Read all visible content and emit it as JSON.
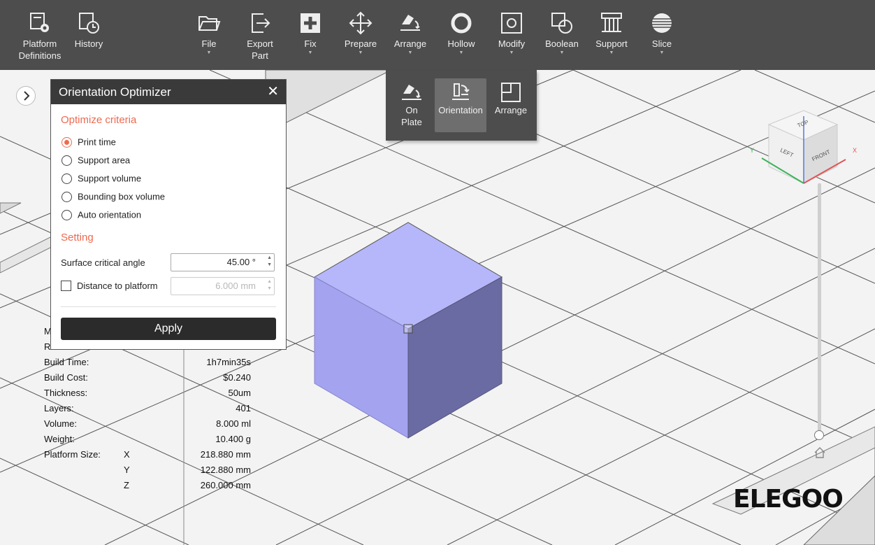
{
  "toolbar": {
    "buttons": [
      {
        "id": "platform",
        "label_line1": "Platform",
        "label_line2": "Definitions",
        "icon": "platform-gear-icon"
      },
      {
        "id": "history",
        "label_line1": "History",
        "label_line2": "",
        "icon": "history-clock-icon"
      },
      {
        "id": "file",
        "label_line1": "File",
        "label_line2": "",
        "icon": "folder-icon"
      },
      {
        "id": "export",
        "label_line1": "Export",
        "label_line2": "Part",
        "icon": "export-icon"
      },
      {
        "id": "fix",
        "label_line1": "Fix",
        "label_line2": "",
        "icon": "fix-plus-icon"
      },
      {
        "id": "prepare",
        "label_line1": "Prepare",
        "label_line2": "",
        "icon": "move-arrows-icon"
      },
      {
        "id": "arrange",
        "label_line1": "Arrange",
        "label_line2": "",
        "icon": "arrange-icon"
      },
      {
        "id": "hollow",
        "label_line1": "Hollow",
        "label_line2": "",
        "icon": "hollow-ring-icon"
      },
      {
        "id": "modify",
        "label_line1": "Modify",
        "label_line2": "",
        "icon": "modify-square-icon"
      },
      {
        "id": "boolean",
        "label_line1": "Boolean",
        "label_line2": "",
        "icon": "boolean-icon"
      },
      {
        "id": "support",
        "label_line1": "Support",
        "label_line2": "",
        "icon": "support-icon"
      },
      {
        "id": "slice",
        "label_line1": "Slice",
        "label_line2": "",
        "icon": "slice-layers-icon"
      }
    ]
  },
  "arrange_menu": {
    "on_plate_line1": "On",
    "on_plate_line2": "Plate",
    "orientation": "Orientation",
    "arrange": "Arrange",
    "active": "orientation"
  },
  "optimizer": {
    "title": "Orientation Optimizer",
    "close": "✕",
    "criteria_title": "Optimize criteria",
    "criteria": [
      {
        "label": "Print time",
        "checked": true
      },
      {
        "label": "Support area",
        "checked": false
      },
      {
        "label": "Support volume",
        "checked": false
      },
      {
        "label": "Bounding box volume",
        "checked": false
      },
      {
        "label": "Auto orientation",
        "checked": false
      }
    ],
    "setting_title": "Setting",
    "surface_angle_label": "Surface critical angle",
    "surface_angle_value": "45.00 °",
    "distance_label": "Distance to platform",
    "distance_value": "6.000 mm",
    "distance_checked": false,
    "apply": "Apply"
  },
  "stats": {
    "partial_1": "M",
    "partial_2": "R",
    "build_time_label": "Build Time:",
    "build_time": "1h7min35s",
    "build_cost_label": "Build Cost:",
    "build_cost": "$0.240",
    "thickness_label": "Thickness:",
    "thickness": "50um",
    "layers_label": "Layers:",
    "layers": "401",
    "volume_label": "Volume:",
    "volume": "8.000 ml",
    "weight_label": "Weight:",
    "weight": "10.400 g",
    "platform_label": "Platform Size:",
    "x_label": "X",
    "x": "218.880 mm",
    "y_label": "Y",
    "y": "122.880 mm",
    "z_label": "Z",
    "z": "260.000 mm"
  },
  "view_cube": {
    "top": "TOP",
    "left": "LEFT",
    "front": "FRONT",
    "axis_x": "X",
    "axis_y": "Y"
  },
  "logo": "ELEGOO",
  "colors": {
    "toolbar_bg": "#4d4d4d",
    "accent": "#ee6a50",
    "model_top": "#b6b6fb",
    "model_left": "#a3a3f0",
    "model_right": "#6b6ba3"
  }
}
